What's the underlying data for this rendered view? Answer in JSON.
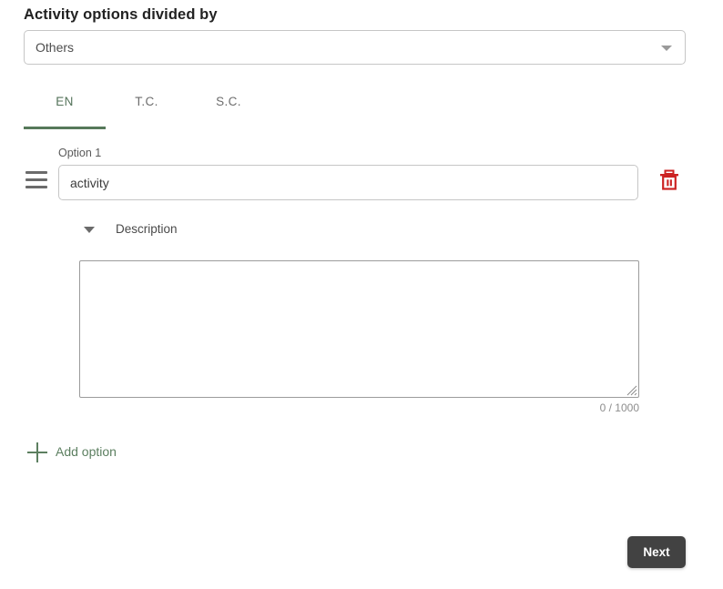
{
  "page": {
    "title": "Activity options divided by"
  },
  "divider_select": {
    "value": "Others",
    "arrow_icon": "chevron-down-icon"
  },
  "language_tabs": {
    "active_index": 0,
    "items": [
      {
        "label": "EN"
      },
      {
        "label": "T.C."
      },
      {
        "label": "S.C."
      }
    ]
  },
  "option": {
    "label": "Option 1",
    "value": "activity",
    "placeholder": "",
    "drag_handle_icon": "drag-handle-icon",
    "delete_icon": "trash-icon",
    "delete_color": "#cc2222"
  },
  "description": {
    "label": "Description",
    "toggle_icon": "caret-down-icon",
    "value": "",
    "placeholder": "",
    "counter": "0 / 1000"
  },
  "add_option": {
    "label": "Add option",
    "icon": "plus-icon",
    "color": "#5c7f60"
  },
  "footer": {
    "next_label": "Next"
  },
  "colors": {
    "accent_green": "#56795a",
    "danger_red": "#cc2222",
    "button_dark": "#424242"
  }
}
